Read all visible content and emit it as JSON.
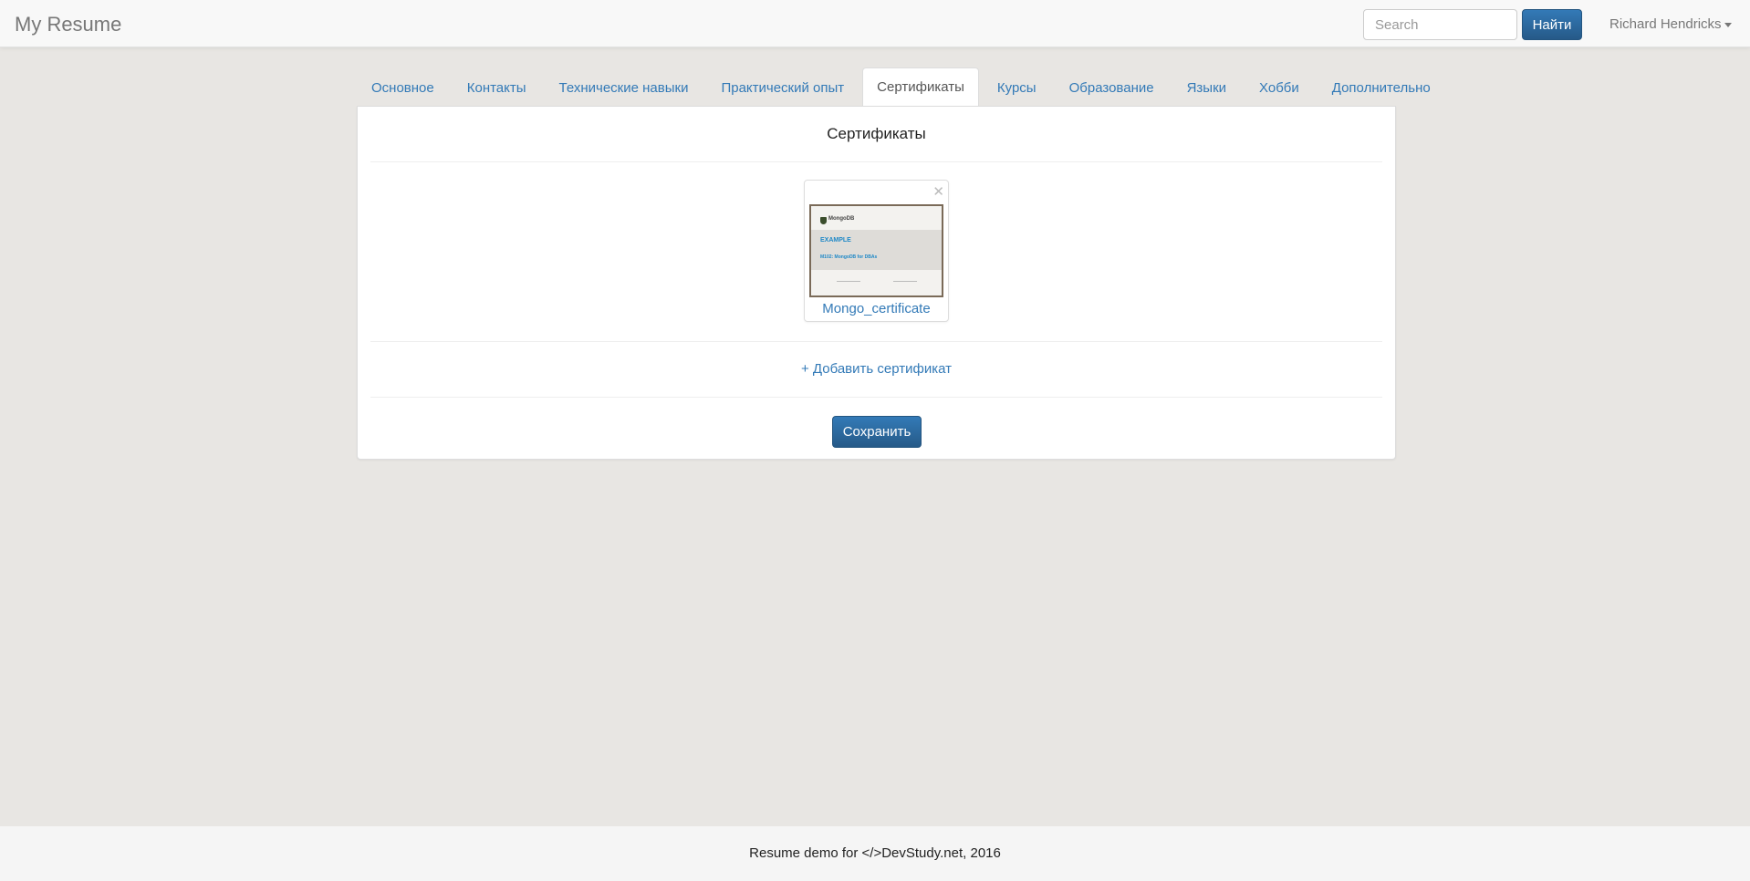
{
  "navbar": {
    "brand": "My Resume",
    "search_placeholder": "Search",
    "search_button": "Найти",
    "user_name": "Richard Hendricks"
  },
  "tabs": [
    {
      "label": "Основное",
      "active": false
    },
    {
      "label": "Контакты",
      "active": false
    },
    {
      "label": "Технические навыки",
      "active": false
    },
    {
      "label": "Практический опыт",
      "active": false
    },
    {
      "label": "Сертификаты",
      "active": true
    },
    {
      "label": "Курсы",
      "active": false
    },
    {
      "label": "Образование",
      "active": false
    },
    {
      "label": "Языки",
      "active": false
    },
    {
      "label": "Хобби",
      "active": false
    },
    {
      "label": "Дополнительно",
      "active": false
    }
  ],
  "panel": {
    "title": "Сертификаты",
    "certificate": {
      "name": "Mongo_certificate",
      "thumbnail": {
        "brand": "MongoDB",
        "example": "EXAMPLE",
        "course": "M102: MongoDB for DBAs"
      }
    },
    "add_link": "+ Добавить сертификат",
    "save_button": "Сохранить"
  },
  "footer": {
    "text": "Resume demo for </>DevStudy.net, 2016"
  },
  "colors": {
    "link": "#337ab7",
    "primary_button": "#2e6da4",
    "background": "#e8e6e3"
  }
}
